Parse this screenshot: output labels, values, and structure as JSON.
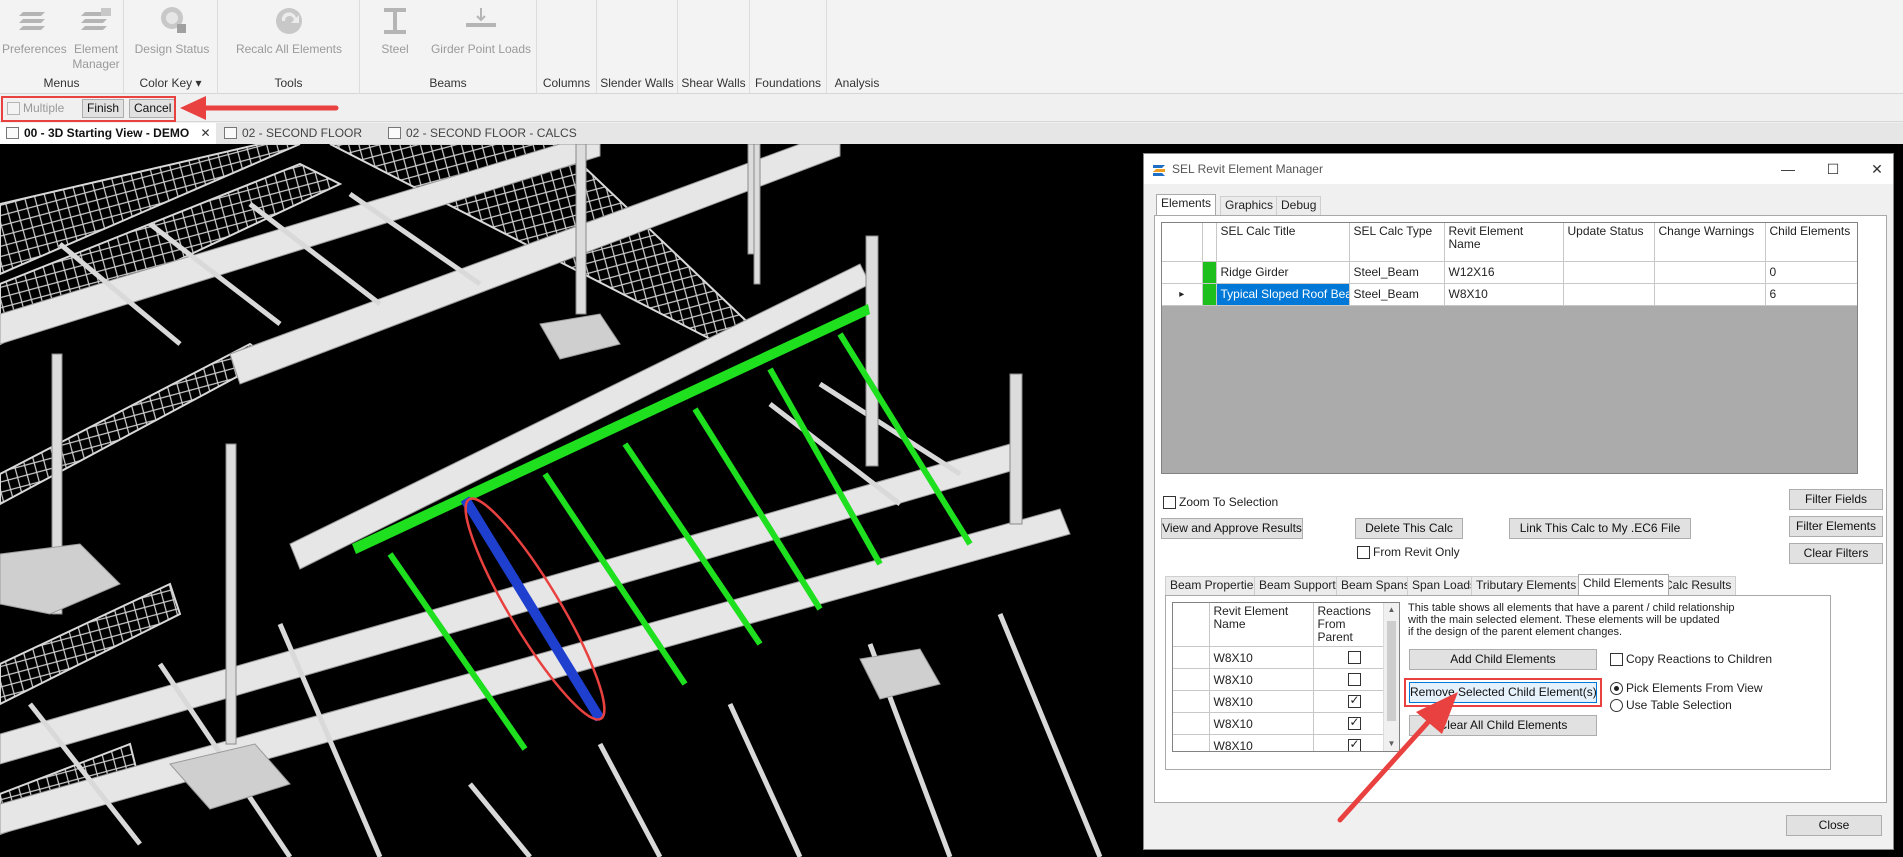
{
  "ribbon": {
    "groups": [
      {
        "label": "Menus",
        "buttons": [
          "Preferences",
          "Element Manager"
        ]
      },
      {
        "label": "Color Key",
        "buttons": [
          "Design Status"
        ]
      },
      {
        "label": "Tools",
        "buttons": [
          "Recalc All Elements"
        ]
      },
      {
        "label": "Beams",
        "buttons": [
          "Steel",
          "Girder Point Loads"
        ]
      }
    ],
    "element_manager_line2": "Manager",
    "element_manager_line1": "Element",
    "color_key_caret": "▾",
    "context_tabs": [
      "Columns",
      "Slender Walls",
      "Shear Walls",
      "Foundations",
      "Analysis"
    ]
  },
  "optionbar": {
    "multiple_label": "Multiple",
    "finish_label": "Finish",
    "cancel_label": "Cancel"
  },
  "viewtabs": [
    {
      "label": "00 - 3D Starting View - DEMO",
      "active": true,
      "close": "✕"
    },
    {
      "label": "02 - SECOND FLOOR"
    },
    {
      "label": "02 - SECOND FLOOR - CALCS"
    }
  ],
  "dialog": {
    "title": "SEL Revit Element Manager",
    "window_controls": {
      "minimize": "—",
      "maximize": "☐",
      "close": "✕"
    },
    "tabs": [
      "Elements",
      "Graphics",
      "Debug"
    ],
    "main_grid": {
      "headers": [
        "SEL Calc Title",
        "SEL Calc Type",
        "Revit Element Name",
        "Update Status",
        "Change Warnings",
        "Child Elements"
      ],
      "rows": [
        {
          "title": "Ridge Girder",
          "type": "Steel_Beam",
          "name": "W12X16",
          "status": "",
          "warnings": "",
          "children": "0"
        },
        {
          "title": "Typical Sloped Roof Beam",
          "type": "Steel_Beam",
          "name": "W8X10",
          "status": "",
          "warnings": "",
          "children": "6",
          "selected": true,
          "current_marker": "▸"
        }
      ]
    },
    "zoom_to_selection": "Zoom To Selection",
    "filter_fields": "Filter Fields",
    "filter_elements": "Filter Elements",
    "clear_filters": "Clear Filters",
    "view_approve": "View and Approve Results",
    "delete_calc": "Delete This Calc",
    "from_revit_only": "From Revit Only",
    "link_calc": "Link This Calc to My .EC6 File",
    "subtabs": [
      "Beam Properties",
      "Beam Supports",
      "Beam Spans",
      "Span Loads",
      "Tributary Elements",
      "Child Elements",
      "Calc Results"
    ],
    "active_subtab": "Child Elements",
    "child_grid": {
      "headers": [
        "Revit Element Name",
        "Reactions From Parent"
      ],
      "rows": [
        {
          "name": "W8X10",
          "checked": false
        },
        {
          "name": "W8X10",
          "checked": false
        },
        {
          "name": "W8X10",
          "checked": true
        },
        {
          "name": "W8X10",
          "checked": true
        },
        {
          "name": "W8X10",
          "checked": true
        }
      ],
      "scroll_up": "▲",
      "scroll_down": "▼"
    },
    "description": [
      "This table shows all elements that have a parent / child relationship",
      "with the main selected element.  These elements will be updated",
      "if the design of the parent element changes."
    ],
    "add_child": "Add Child Elements",
    "copy_reactions": "Copy Reactions to Children",
    "remove_child": "Remove Selected Child Element(s)",
    "pick_from_view": "Pick Elements From View",
    "use_table_selection": "Use Table Selection",
    "clear_all_child": "Clear All Child Elements",
    "close": "Close"
  },
  "colors": {
    "annotation_red": "#e8413f",
    "selected_beam_blue": "#1f3fcf",
    "child_beam_green": "#1ee01e",
    "selection_blue": "#0078d7",
    "status_green": "#1dbf1d"
  }
}
